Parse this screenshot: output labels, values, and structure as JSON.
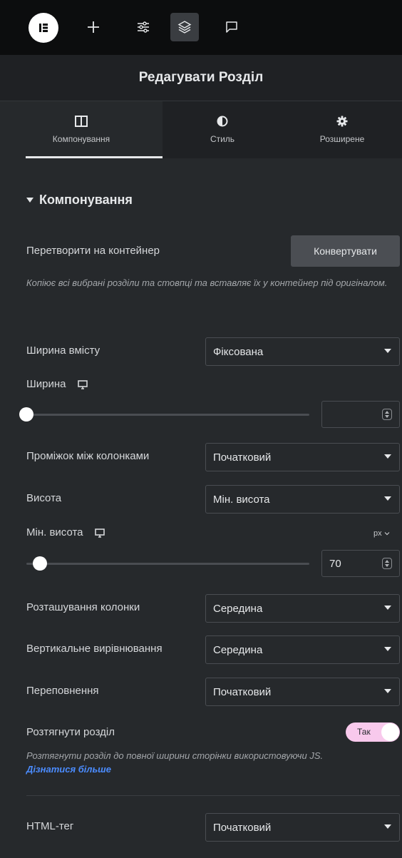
{
  "toolbar": {
    "logo_letter": "E",
    "add_icon": "plus-icon",
    "settings_icon": "sliders-icon",
    "layers_icon": "layers-icon",
    "comments_icon": "chat-icon"
  },
  "header": {
    "title": "Редагувати Розділ"
  },
  "tabs": [
    {
      "label": "Компонування",
      "icon": "columns-icon",
      "active": true
    },
    {
      "label": "Стиль",
      "icon": "contrast-icon",
      "active": false
    },
    {
      "label": "Розширене",
      "icon": "gear-icon",
      "active": false
    }
  ],
  "section": {
    "title": "Компонування"
  },
  "convert": {
    "label": "Перетворити на контейнер",
    "button": "Конвертувати",
    "note": "Копіює всі вибрані розділи та стовпці та вставляє їх у контейнер під оригіналом."
  },
  "content_width": {
    "label": "Ширина вмісту",
    "value": "Фіксована"
  },
  "width": {
    "label": "Ширина",
    "value": ""
  },
  "column_gap": {
    "label": "Проміжок між колонками",
    "value": "Початковий"
  },
  "height": {
    "label": "Висота",
    "value": "Мін. висота"
  },
  "min_height": {
    "label": "Мін. висота",
    "unit": "px",
    "value": "70"
  },
  "column_position": {
    "label": "Розташування колонки",
    "value": "Середина"
  },
  "vertical_align": {
    "label": "Вертикальне вирівнювання",
    "value": "Середина"
  },
  "overflow": {
    "label": "Переповнення",
    "value": "Початковий"
  },
  "stretch": {
    "label": "Розтягнути розділ",
    "toggle_label": "Так",
    "note": "Розтягнути розділ до повної ширини сторінки використовуючи JS.",
    "link": "Дізнатися більше"
  },
  "html_tag": {
    "label": "HTML-тег",
    "value": "Початковий"
  },
  "colors": {
    "panel_bg": "#26292c",
    "toggle_on": "#f8c9ec",
    "link": "#4b8cff"
  }
}
